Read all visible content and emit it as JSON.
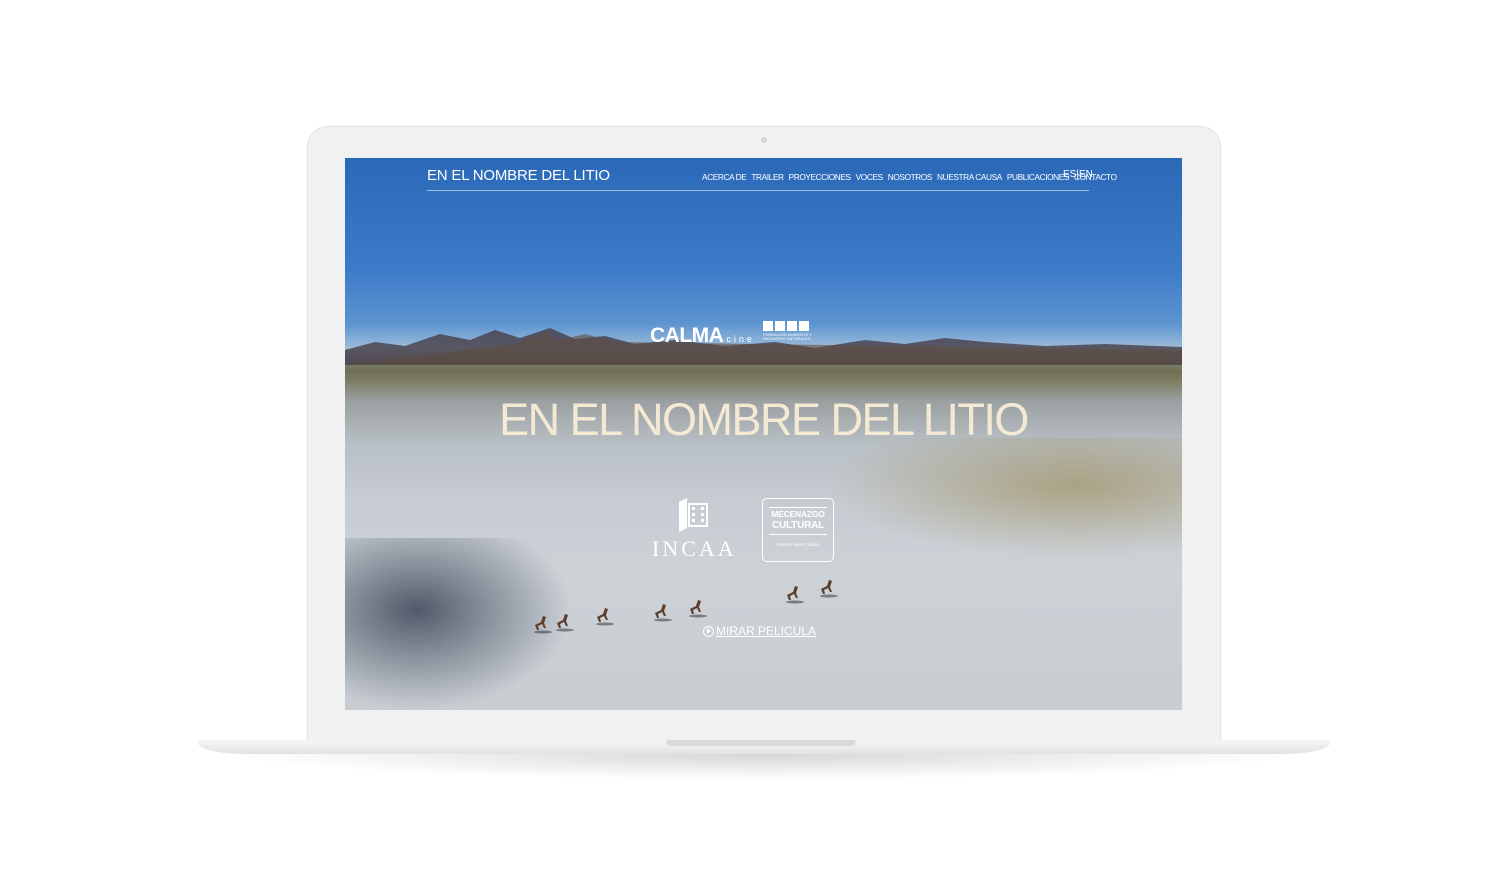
{
  "nav": {
    "site_title": "EN EL NOMBRE DEL LITIO",
    "menu": [
      "ACERCA DE",
      "TRAILER",
      "PROYECCIONES",
      "VOCES",
      "NOSOTROS",
      "NUESTRA CAUSA",
      "PUBLICACIONES",
      "CONTACTO"
    ],
    "lang": "ES|EN"
  },
  "logos": {
    "calma_main": "CALMA",
    "calma_sub": "cine",
    "farn_text": "FUNDACIÓN AMBIENTE Y RECURSOS NATURALES",
    "incaa": "INCAA",
    "mecenazgo_line1": "MECENAZGO",
    "mecenazgo_line2": "CULTURAL",
    "mecenazgo_line3": "Buenos Aires Ciudad"
  },
  "hero": {
    "title": "EN EL NOMBRE DEL LITIO",
    "watch_label": "MIRAR PELICULA"
  },
  "icons": {
    "play": "play-circle-icon",
    "incaa": "film-frame-icon"
  },
  "colors": {
    "sky": "#2b69b8",
    "title": "#f4ead4",
    "salt_flat": "#c6ccd2"
  }
}
